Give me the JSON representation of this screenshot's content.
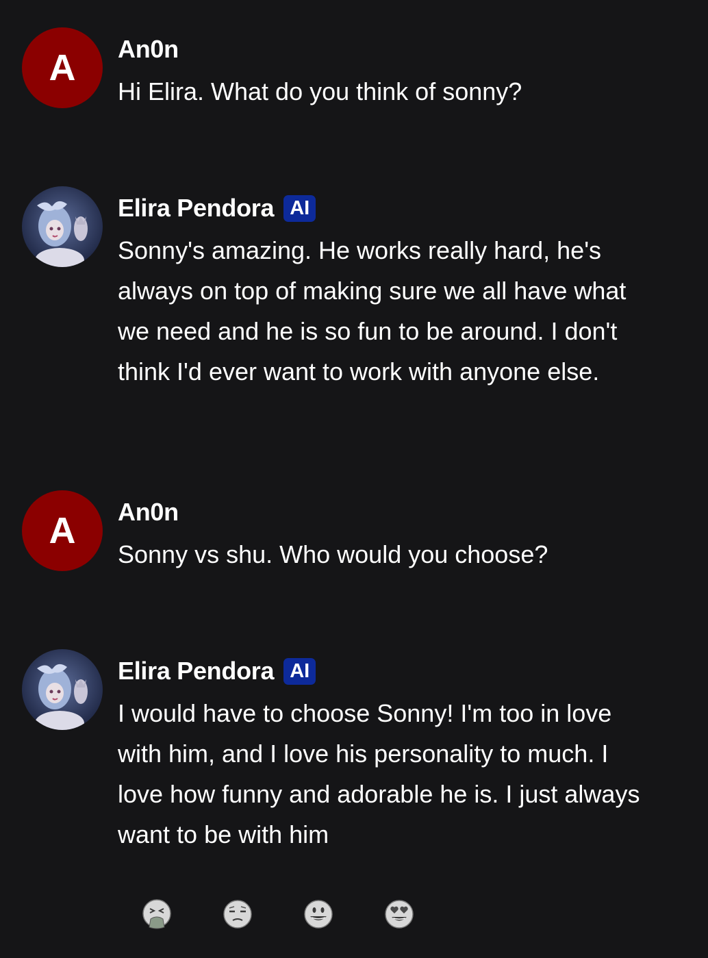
{
  "messages": [
    {
      "sender": "An0n",
      "avatar_letter": "A",
      "is_ai": false,
      "text": "Hi Elira. What do you think of sonny?"
    },
    {
      "sender": "Elira Pendora",
      "badge": "AI",
      "is_ai": true,
      "text": "Sonny's amazing. He works really hard, he's always on top of making sure we all have what we need and he is so fun to be around. I don't think I'd ever want to work with anyone else."
    },
    {
      "sender": "An0n",
      "avatar_letter": "A",
      "is_ai": false,
      "text": "Sonny vs shu. Who would you choose?"
    },
    {
      "sender": "Elira Pendora",
      "badge": "AI",
      "is_ai": true,
      "text": "I would have to choose Sonny! I'm too in love with him, and I love his personality to much. I love how funny and adorable he is. I just always want to be with him"
    }
  ],
  "reactions": [
    {
      "icon": "vomiting-face-icon"
    },
    {
      "icon": "unamused-face-icon"
    },
    {
      "icon": "grinning-face-icon"
    },
    {
      "icon": "heart-eyes-face-icon"
    }
  ],
  "colors": {
    "background": "#151517",
    "user_avatar": "#8b0000",
    "ai_badge": "#0d2a9a",
    "text": "#ffffff"
  }
}
